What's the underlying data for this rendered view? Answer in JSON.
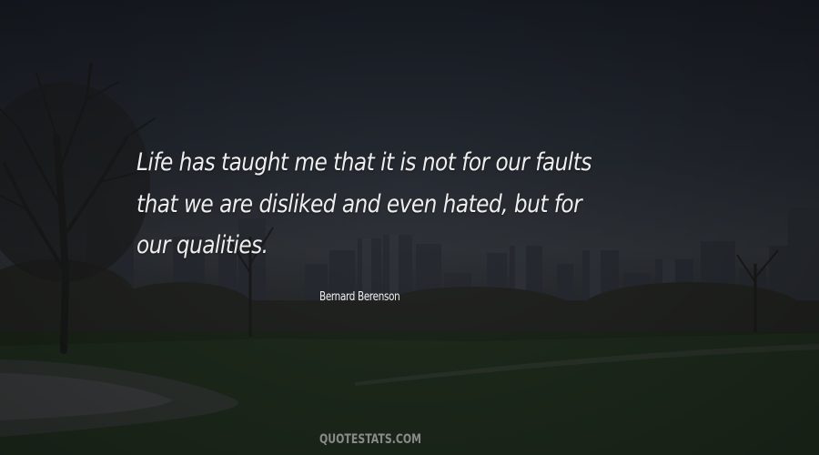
{
  "quote": {
    "lines": [
      "Life has taught me that it is not for our faults",
      "that we are disliked and even hated, but for",
      "our qualities."
    ],
    "author": "Bernard Berenson"
  },
  "watermark": "QUOTESTATS.COM",
  "colors": {
    "text": "#eeeeee",
    "watermark": "#8a8a8a",
    "sky": "#262b33",
    "grass": "#1f2a1c"
  }
}
